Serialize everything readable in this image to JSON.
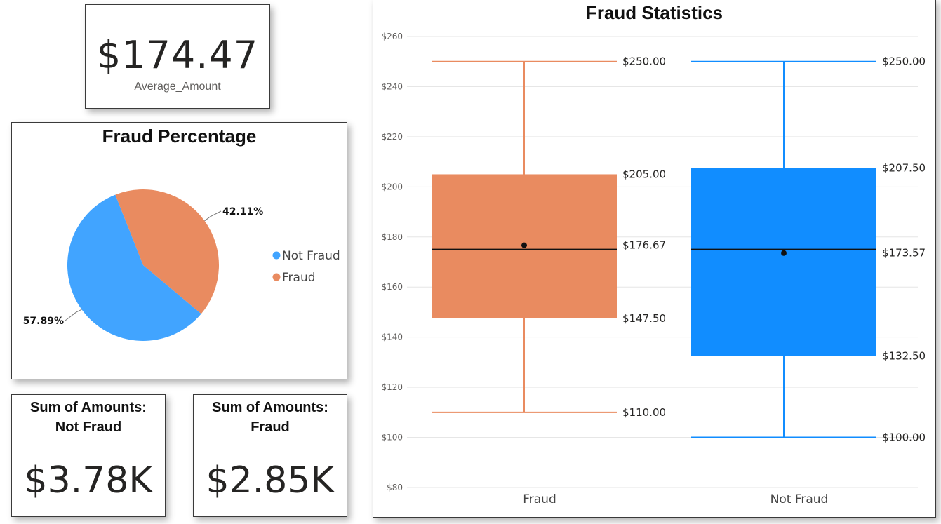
{
  "kpi_average": {
    "value": "$174.47",
    "label": "Average_Amount"
  },
  "pie_card": {
    "title": "Fraud Percentage",
    "legend": [
      {
        "label": "Not Fraud",
        "color": "#41A4FF"
      },
      {
        "label": "Fraud",
        "color": "#E98B60"
      }
    ]
  },
  "sum_not_fraud": {
    "title_line1": "Sum of Amounts:",
    "title_line2": "Not Fraud",
    "value": "$3.78K"
  },
  "sum_fraud": {
    "title_line1": "Sum of Amounts:",
    "title_line2": "Fraud",
    "value": "$2.85K"
  },
  "box_card": {
    "title": "Fraud Statistics"
  },
  "chart_data": [
    {
      "type": "pie",
      "title": "Fraud Percentage",
      "slices": [
        {
          "label": "Fraud",
          "value": 42.11,
          "display": "42.11%",
          "color": "#E98B60"
        },
        {
          "label": "Not Fraud",
          "value": 57.89,
          "display": "57.89%",
          "color": "#41A4FF"
        }
      ],
      "legend_position": "right"
    },
    {
      "type": "boxplot",
      "title": "Fraud Statistics",
      "categories": [
        "Fraud",
        "Not Fraud"
      ],
      "ylim": [
        80,
        260
      ],
      "y_ticks": [
        "$80",
        "$100",
        "$120",
        "$140",
        "$160",
        "$180",
        "$200",
        "$220",
        "$240",
        "$260"
      ],
      "grid": true,
      "series": [
        {
          "category": "Fraud",
          "color": "#E98B60",
          "min": 110,
          "q1": 147.5,
          "median": 175,
          "mean": 176.67,
          "q3": 205,
          "max": 250,
          "labels": {
            "min": "$110.00",
            "q1": "$147.50",
            "mean": "$176.67",
            "q3": "$205.00",
            "max": "$250.00"
          }
        },
        {
          "category": "Not Fraud",
          "color": "#118DFF",
          "min": 100,
          "q1": 132.5,
          "median": 175,
          "mean": 173.57,
          "q3": 207.5,
          "max": 250,
          "labels": {
            "min": "$100.00",
            "q1": "$132.50",
            "mean": "$173.57",
            "q3": "$207.50",
            "max": "$250.00"
          }
        }
      ]
    }
  ]
}
